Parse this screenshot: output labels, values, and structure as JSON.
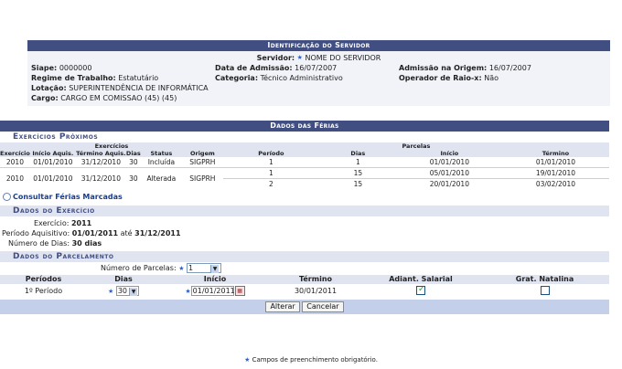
{
  "server": {
    "title": "Identificação do Servidor",
    "servidor_label": "Servidor:",
    "servidor_value": "NOME DO SERVIDOR",
    "siape_label": "Siape:",
    "siape_value": "0000000",
    "admissao_label": "Data de Admissão:",
    "admissao_value": "16/07/2007",
    "admissao_origem_label": "Admissão na Origem:",
    "admissao_origem_value": "16/07/2007",
    "regime_label": "Regime de Trabalho:",
    "regime_value": "Estatutário",
    "categoria_label": "Categoria:",
    "categoria_value": "Técnico Administrativo",
    "raiox_label": "Operador de Raio-x:",
    "raiox_value": "Não",
    "lotacao_label": "Lotação:",
    "lotacao_value": "SUPERINTENDÊNCIA DE INFORMÁTICA",
    "cargo_label": "Cargo:",
    "cargo_value": "CARGO EM COMISSAO (45) (45)"
  },
  "ferias": {
    "title": "Dados das Férias",
    "exercicios_title": "Exercícios Próximos",
    "group_exercicios": "Exercícios",
    "group_parcelas": "Parcelas",
    "columns": [
      "Exercício",
      "Início Aquis.",
      "Término Aquis.",
      "Dias",
      "Status",
      "Origem",
      "Período",
      "Dias",
      "Início",
      "Término"
    ],
    "rows": [
      {
        "exercicio": "2010",
        "inicio": "01/01/2010",
        "termino": "31/12/2010",
        "dias": "30",
        "status": "Incluída",
        "origem": "SIGPRH",
        "parcelas": [
          {
            "periodo": "1",
            "dias": "1",
            "inicio": "01/01/2010",
            "termino": "01/01/2010"
          }
        ]
      },
      {
        "exercicio": "2010",
        "inicio": "01/01/2010",
        "termino": "31/12/2010",
        "dias": "30",
        "status": "Alterada",
        "origem": "SIGPRH",
        "parcelas": [
          {
            "periodo": "1",
            "dias": "15",
            "inicio": "05/01/2010",
            "termino": "19/01/2010"
          },
          {
            "periodo": "2",
            "dias": "15",
            "inicio": "20/01/2010",
            "termino": "03/02/2010"
          }
        ]
      }
    ],
    "consultar_link": "Consultar Férias Marcadas",
    "dados_exercicio_title": "Dados do Exercício",
    "exercicio_label": "Exercício:",
    "exercicio_value": "2011",
    "periodo_label": "Período Aquisitivo:",
    "periodo_inicio": "01/01/2011",
    "periodo_ate": "até",
    "periodo_fim": "31/12/2011",
    "num_dias_label": "Número de Dias:",
    "num_dias_value": "30 dias",
    "parcelamento_title": "Dados do Parcelamento",
    "num_parcelas_label": "Número de Parcelas:",
    "num_parcelas_value": "1",
    "par_columns": [
      "Períodos",
      "Dias",
      "Início",
      "Término",
      "Adiant. Salarial",
      "Grat. Natalina"
    ],
    "par_row": {
      "periodo": "1º Período",
      "dias": "30",
      "inicio": "01/01/2011",
      "termino": "30/01/2011",
      "adiant": true,
      "grat": false
    },
    "btn_alterar": "Alterar",
    "btn_cancelar": "Cancelar"
  },
  "footnote": "Campos de preenchimento obrigatório."
}
